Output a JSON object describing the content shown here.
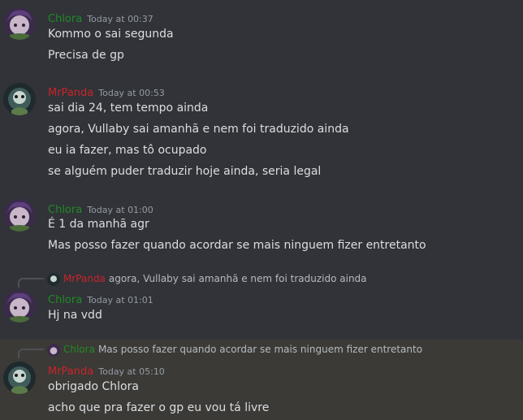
{
  "colors": {
    "background": "#313338",
    "chlora": "#1f8b24",
    "mrpanda": "#c9242a",
    "highlight": "#3b3a36"
  },
  "users": {
    "chlora": "Chlora",
    "mrpanda": "MrPanda"
  },
  "messages": [
    {
      "author": "Chlora",
      "time": "Today at 00:37",
      "lines": [
        "Kommo o sai segunda",
        "Precisa de gp"
      ]
    },
    {
      "author": "MrPanda",
      "time": "Today at 00:53",
      "lines": [
        "sai dia 24, tem tempo ainda",
        "agora, Vullaby sai amanhã e nem foi traduzido ainda",
        "eu ia fazer, mas tô ocupado",
        "se alguém puder traduzir hoje ainda, seria legal"
      ]
    },
    {
      "author": "Chlora",
      "time": "Today at 01:00",
      "lines": [
        "É 1 da manhã agr",
        "Mas posso fazer quando acordar se mais ninguem fizer entretanto"
      ]
    },
    {
      "reply_to": {
        "author": "MrPanda",
        "text": "agora, Vullaby sai amanhã e nem foi traduzido ainda"
      },
      "author": "Chlora",
      "time": "Today at 01:01",
      "lines": [
        "Hj na vdd"
      ]
    },
    {
      "reply_to": {
        "author": "Chlora",
        "text": "Mas posso fazer quando acordar se mais ninguem fizer entretanto"
      },
      "author": "MrPanda",
      "time": "Today at 05:10",
      "lines": [
        "obrigado Chlora",
        "acho que pra fazer o gp eu vou tá livre"
      ]
    }
  ]
}
